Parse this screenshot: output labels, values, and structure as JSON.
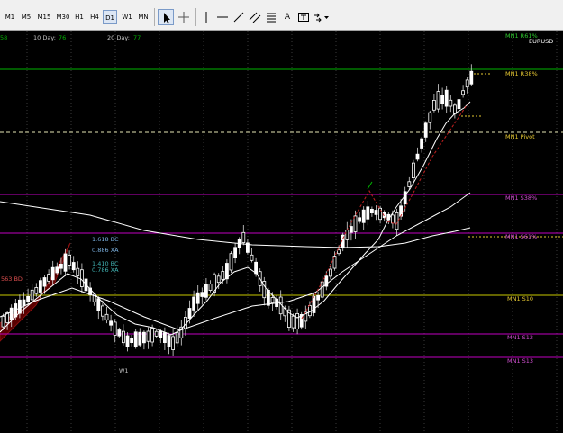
{
  "toolbar": {
    "timeframes": [
      {
        "label": "M1",
        "active": false
      },
      {
        "label": "M5",
        "active": false
      },
      {
        "label": "M15",
        "active": false
      },
      {
        "label": "M30",
        "active": false
      },
      {
        "label": "H1",
        "active": false
      },
      {
        "label": "H4",
        "active": false
      },
      {
        "label": "D1",
        "active": true
      },
      {
        "label": "W1",
        "active": false
      },
      {
        "label": "MN",
        "active": false
      }
    ],
    "text_tool_label": "A"
  },
  "chart": {
    "symbol": "EURUSD",
    "overlay_text": {
      "partial_value": "58",
      "ten_day_label": "10 Day:",
      "ten_day_value": "76",
      "twenty_day_label": "20 Day:",
      "twenty_day_value": "77"
    },
    "levels": {
      "mn1_r61": "MN1 R61%",
      "mn1_r38": "MN1 R38%",
      "mn1_pivot": "MN1 Pivot",
      "mn1_s38": "MN1 S38%",
      "mn1_s61": "MN1 S61%",
      "mn1_s10": "MN1 S10",
      "mn1_s12": "MN1 S12",
      "mn1_s13": "MN1 S13"
    },
    "pattern_labels": {
      "l1": "1.618 BC",
      "l2": "0.886 XA",
      "l3": "1.410 BC",
      "l4": "0.786 XA",
      "left": "563 BD",
      "w1": "W1"
    },
    "colors": {
      "background": "#000000",
      "r61_line": "#00c000",
      "pivot_line": "#e6e6b4",
      "magenta_lines": "#c000c0",
      "s10_line": "#c8c800",
      "level_text_yellow": "#e6c832",
      "level_text_magenta": "#d050d0",
      "level_text_green": "#2ec82e",
      "moving_average": "#ffffff",
      "trend_line": "#d02020",
      "pattern_fill": "#6a0000",
      "ten_day_value": "#00b400"
    }
  }
}
